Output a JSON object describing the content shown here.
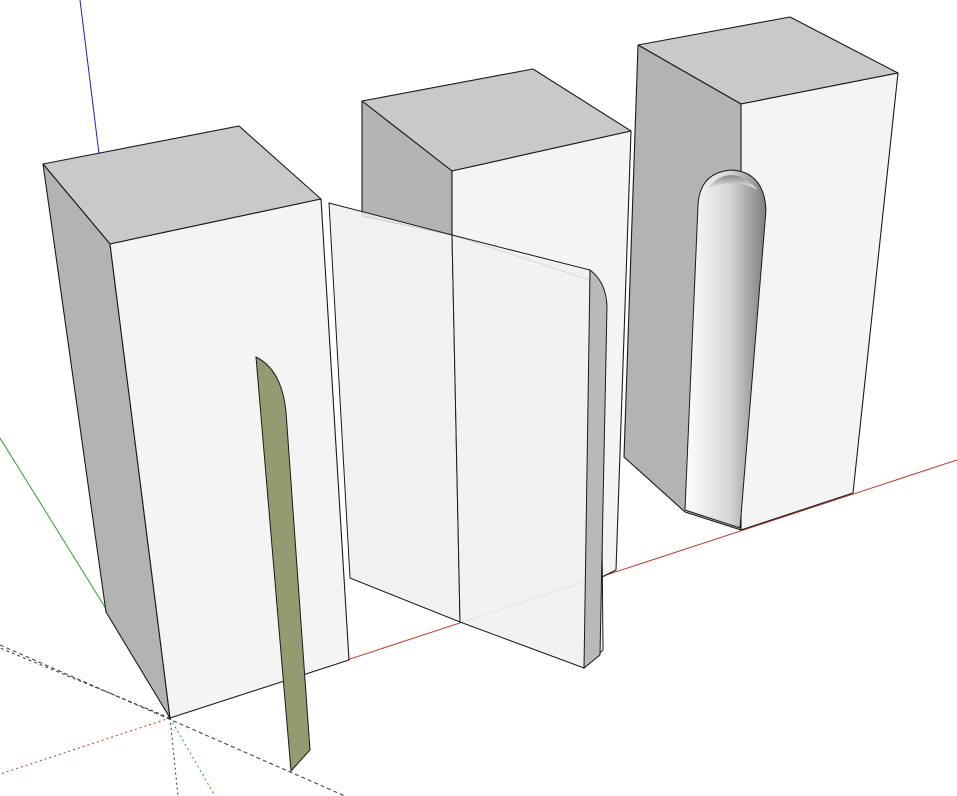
{
  "viewport": {
    "background": "#ffffff"
  },
  "axes": {
    "red": "#c0392b",
    "green": "#2e9e2e",
    "blue": "#2020b0",
    "guide": "#333333"
  },
  "materials": {
    "top_face": "#c9c9c9",
    "side_face": "#b3b3b3",
    "front_face": "#f4f4f4",
    "edge": "#1a1a1a",
    "selected_face": "#969a70",
    "arch_shadow": "#8c8c8c"
  }
}
